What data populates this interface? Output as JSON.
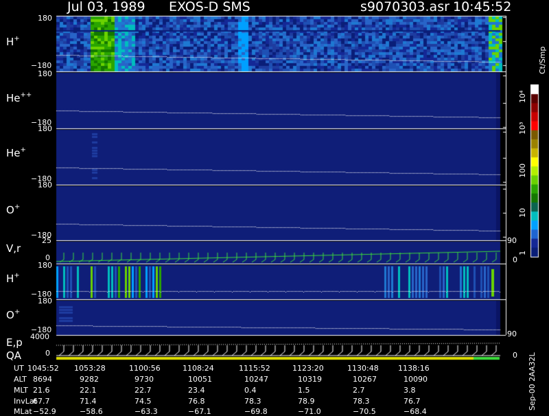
{
  "header": {
    "date": "Jul 03, 1989",
    "instrument": "EXOS-D SMS",
    "file": "s9070303.asr",
    "time": "10:45:52"
  },
  "panels": [
    {
      "species": "H",
      "charge": "+",
      "ymax": "180",
      "ymin": "−180"
    },
    {
      "species": "He",
      "charge": "++",
      "ymax": "180",
      "ymin": "−180"
    },
    {
      "species": "He",
      "charge": "+",
      "ymax": "180",
      "ymin": "−180"
    },
    {
      "species": "O",
      "charge": "+",
      "ymax": "180",
      "ymin": "−180"
    },
    {
      "species": "V,r",
      "charge": "",
      "ymax": "25",
      "ymin": "0",
      "right": "90",
      "right_low": "0"
    },
    {
      "species": "H",
      "charge": "+",
      "ymax": "180",
      "ymin": "−180"
    },
    {
      "species": "O",
      "charge": "+",
      "ymax": "180",
      "ymin": "−180",
      "right": "90"
    },
    {
      "species": "E,p",
      "charge": "",
      "ymax": "4000",
      "ymin": "0",
      "extra_label": "QA",
      "right_low": "0"
    }
  ],
  "colorbar": {
    "unit": "Ct/Smp",
    "labels": [
      "10⁴",
      "10³",
      "100",
      "10",
      "1"
    ],
    "colors": [
      "#ffffff",
      "#5a0000",
      "#8c0000",
      "#c80000",
      "#ff0000",
      "#7a5a00",
      "#9a8200",
      "#c8b400",
      "#ffff00",
      "#b4f000",
      "#6ad200",
      "#2aa500",
      "#147800",
      "#0a6450",
      "#00bebe",
      "#00a0ff",
      "#1e64d2",
      "#142896",
      "#0a1e78"
    ]
  },
  "footer": {
    "rows": [
      {
        "label": "UT",
        "values": [
          "1045:52",
          "1053:28",
          "1100:56",
          "1108:24",
          "1115:52",
          "1123:20",
          "1130:48",
          "1138:16"
        ]
      },
      {
        "label": "ALT",
        "values": [
          "8694",
          "9282",
          "9730",
          "10051",
          "10247",
          "10319",
          "10267",
          "10090"
        ]
      },
      {
        "label": "MLT",
        "values": [
          "21.6",
          "22.1",
          "22.7",
          "23.4",
          "0.4",
          "1.5",
          "2.7",
          "3.8"
        ]
      },
      {
        "label": "InvLat",
        "values": [
          "67.7",
          "71.4",
          "74.5",
          "76.8",
          "78.3",
          "78.9",
          "78.3",
          "76.7"
        ]
      },
      {
        "label": "MLat",
        "values": [
          "−52.9",
          "−58.6",
          "−63.3",
          "−67.1",
          "−69.8",
          "−71.0",
          "−70.5",
          "−68.4"
        ]
      }
    ],
    "stamp": "Sep-00 2AA32L"
  },
  "colors": {
    "background": "#000000",
    "panel_bg": "#0f1e78",
    "sweep": "#3cdc3c",
    "text": "#ffffff"
  },
  "chart_data": {
    "type": "heatmap",
    "title": "Jul 03, 1989   EXOS-D SMS   s9070303.asr   10:45:52",
    "x_ticks_UT": [
      "1045:52",
      "1053:28",
      "1100:56",
      "1108:24",
      "1115:52",
      "1123:20",
      "1130:48",
      "1138:16"
    ],
    "y_range": [
      -180,
      180
    ],
    "ion_species": [
      "H+",
      "He++",
      "He+",
      "O+",
      "H+",
      "O+"
    ],
    "colorscale_counts": [
      1,
      10,
      100,
      1000,
      10000
    ]
  }
}
